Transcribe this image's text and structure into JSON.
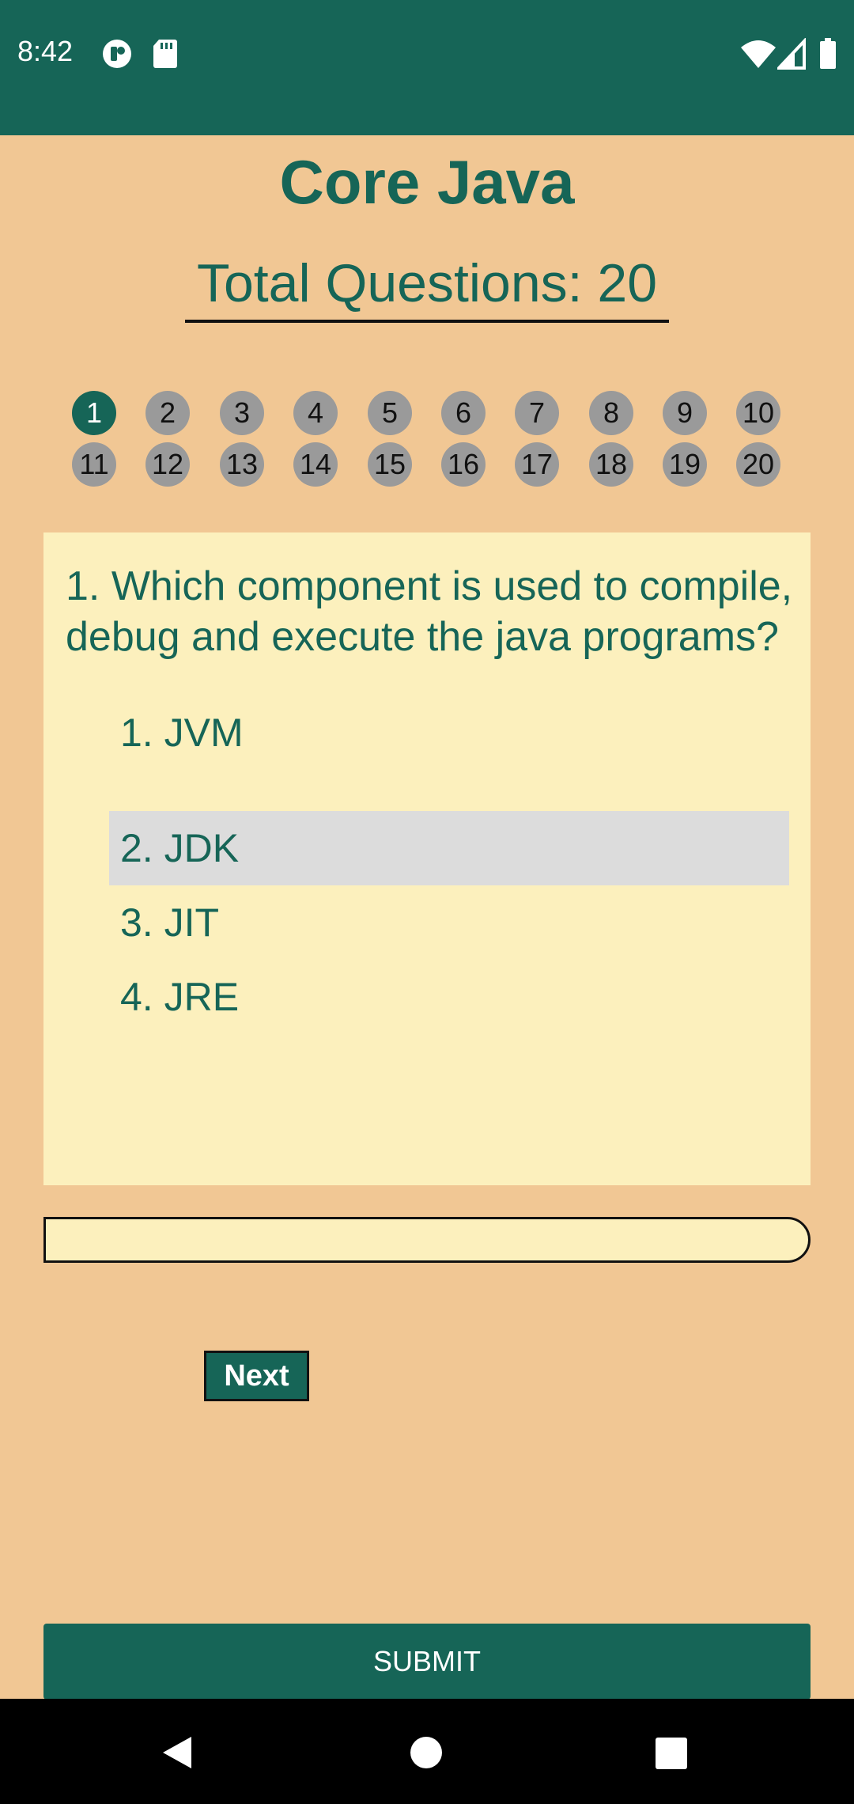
{
  "status_bar": {
    "time": "8:42",
    "left_icons": [
      "notification-icon",
      "sd-card-icon"
    ],
    "right_icons": [
      "wifi-icon",
      "signal-icon",
      "battery-icon"
    ]
  },
  "quiz": {
    "title": "Core Java",
    "total_questions_label": "Total Questions: 20",
    "question_numbers": [
      "1",
      "2",
      "3",
      "4",
      "5",
      "6",
      "7",
      "8",
      "9",
      "10",
      "11",
      "12",
      "13",
      "14",
      "15",
      "16",
      "17",
      "18",
      "19",
      "20"
    ],
    "current_question": "1",
    "question_text": "1. Which component is used to compile, debug and execute the java programs?",
    "options": [
      "1. JVM",
      "2. JDK",
      "3. JIT",
      "4. JRE"
    ],
    "selected_option": "2. JDK",
    "progress": 0,
    "next_label": "Next",
    "submit_label": "SUBMIT"
  },
  "colors": {
    "primary": "#166557",
    "background": "#f1c794",
    "card": "#fcf0bd",
    "selected": "#dcdcdc",
    "inactive_number": "#9a9a9a"
  },
  "nav_bar": {
    "icons": [
      "back-icon",
      "home-icon",
      "recents-icon"
    ]
  }
}
